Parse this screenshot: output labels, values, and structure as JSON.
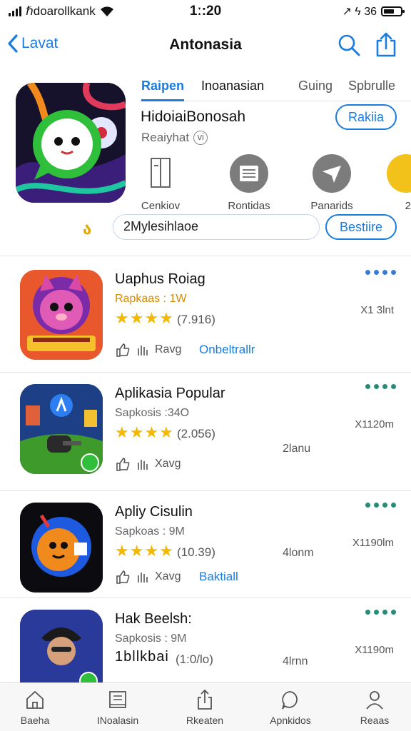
{
  "status": {
    "carrier": "ℏdoarollkank",
    "time": "1ː:20",
    "right_text": "↗ ϟ 36"
  },
  "nav": {
    "back_label": "Lavat",
    "title": "Antonasia"
  },
  "featured": {
    "tabs": [
      {
        "label": "Raipen"
      },
      {
        "label": "Inoanasian"
      },
      {
        "label": "Guing"
      },
      {
        "label": "Spbrulle"
      }
    ],
    "name": "HidoiaiBonosah",
    "subtitle": "Reaiyhat",
    "info_glyph": "ⅵ",
    "rank_button": "Rakiia",
    "actions": [
      {
        "label": "Cenkiov",
        "icon": "panel-icon"
      },
      {
        "label": "Rontidas",
        "icon": "list-icon"
      },
      {
        "label": "Panarids",
        "icon": "plane-icon"
      },
      {
        "label": "2",
        "icon": "yellow-circle-icon"
      }
    ],
    "promo_mark": "ა",
    "promo_text": "2Mylesihlaoe",
    "secondary_button": "Bestiire"
  },
  "apps": [
    {
      "name": "Uaphus Roiag",
      "sub": "Rapkaas : 1W",
      "stars": "★★★★",
      "count": "(7.916)",
      "meta": "Ravg",
      "link": "Onbeltrallr",
      "size": "X1 3lnt",
      "mid": "",
      "dots": "blue"
    },
    {
      "name": "Aplikasia Popular",
      "sub": "Sapkosis :34O",
      "stars": "★★★★",
      "count": "(2.056)",
      "meta": "Xavg",
      "link": "",
      "size": "X1120m",
      "mid": "2lanu",
      "dots": "green"
    },
    {
      "name": "Apliy Cisulin",
      "sub": "Sapkoas : 9M",
      "stars": "★★★★",
      "count": "(10.39)",
      "meta": "Xavg",
      "link": "Baktiall",
      "size": "X1190lm",
      "mid": "4lonm",
      "dots": "green"
    },
    {
      "name": "Hak Beelsh:",
      "sub": "Sapkosis : 9M",
      "stars": "1bllkbai",
      "count": "(1:0/lo)",
      "meta": "",
      "link": "",
      "size": "X1190m",
      "mid": "4lrnn",
      "dots": "green"
    }
  ],
  "tabbar": [
    {
      "label": "Baeha"
    },
    {
      "label": "INoalasin"
    },
    {
      "label": "Rkeaten"
    },
    {
      "label": "Apnkidos"
    },
    {
      "label": "Reaas"
    }
  ],
  "colors": {
    "accent": "#1a7be0",
    "star": "#f5b800",
    "dots_green": "#2a8a78"
  }
}
